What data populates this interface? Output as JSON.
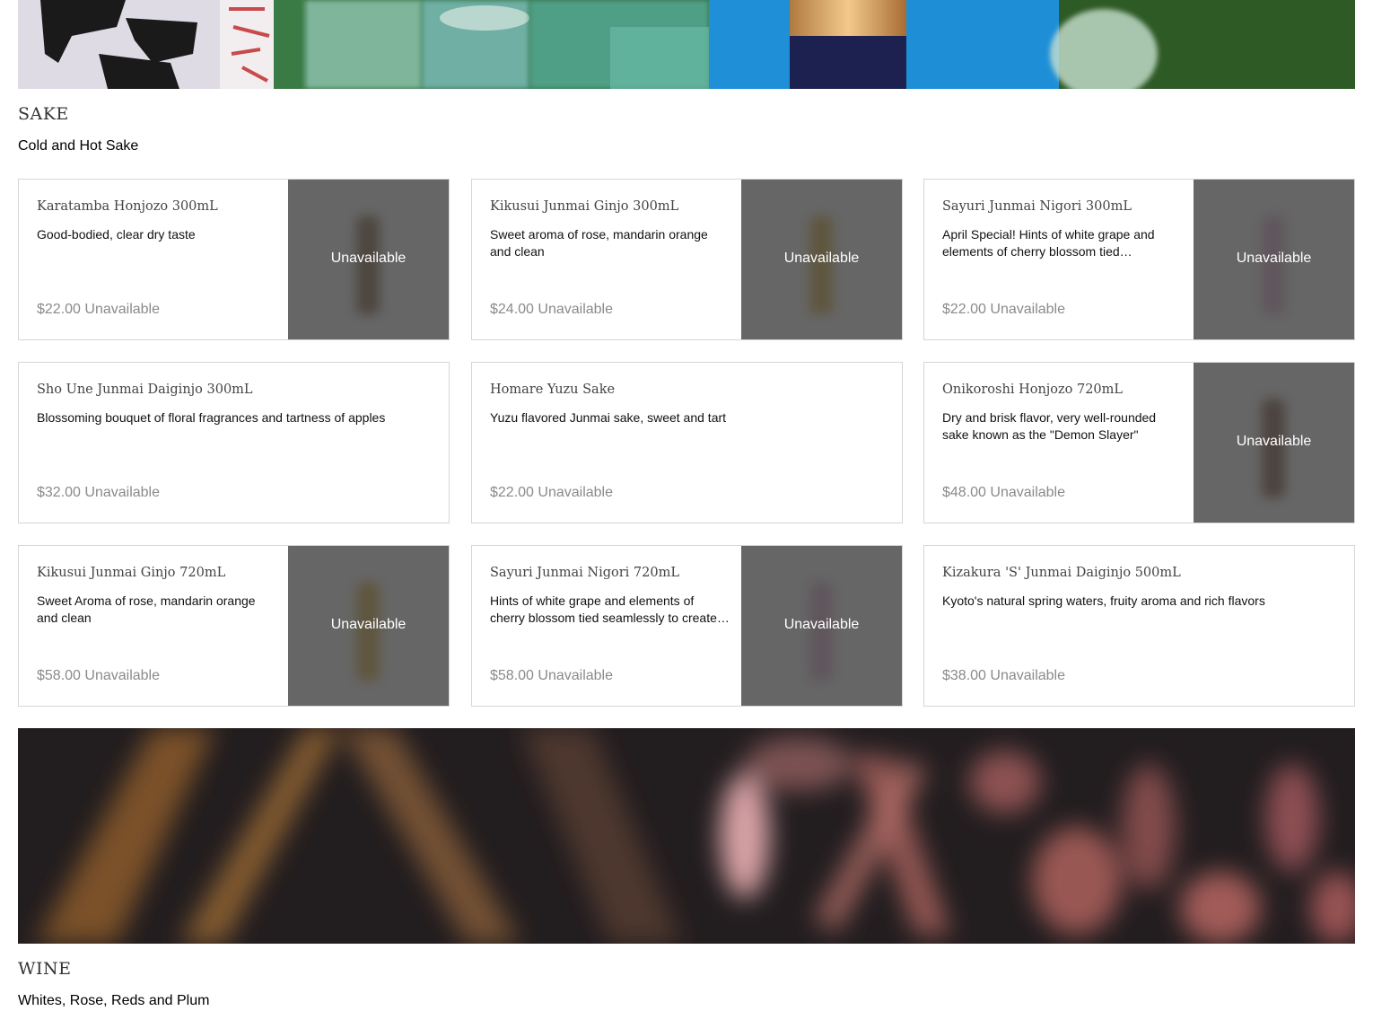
{
  "sections": [
    {
      "title": "SAKE",
      "subtitle": "Cold and Hot Sake"
    },
    {
      "title": "WINE",
      "subtitle": "Whites, Rose, Reds and Plum"
    }
  ],
  "overlay_label": "Unavailable",
  "items": [
    {
      "name": "Karatamba Honjozo 300mL",
      "description": "Good-bodied, clear dry taste",
      "price": "$22.00",
      "status": "Unavailable",
      "bottle_color": "#3a2e22"
    },
    {
      "name": "Kikusui Junmai Ginjo 300mL",
      "description": "Sweet aroma of rose, mandarin orange and clean",
      "price": "$24.00",
      "status": "Unavailable",
      "bottle_color": "#5a4a20"
    },
    {
      "name": "Sayuri Junmai Nigori 300mL",
      "description": "April Special! Hints of white grape and elements of cherry blossom tied seamlessly to create a creamy texture",
      "price": "$22.00",
      "status": "Unavailable",
      "bottle_color": "#5a4a55"
    },
    {
      "name": "Sho Une Junmai Daiginjo 300mL",
      "description": "Blossoming bouquet of floral fragrances and tartness of apples",
      "price": "$32.00",
      "status": "Unavailable"
    },
    {
      "name": "Homare Yuzu Sake",
      "description": "Yuzu flavored Junmai sake, sweet and tart",
      "price": "$22.00",
      "status": "Unavailable"
    },
    {
      "name": "Onikoroshi Honjozo 720mL",
      "description": "Dry and brisk flavor, very well-rounded sake known as the \"Demon Slayer\"",
      "price": "$48.00",
      "status": "Unavailable",
      "bottle_color": "#3a2820"
    },
    {
      "name": "Kikusui Junmai Ginjo 720mL",
      "description": "Sweet Aroma of rose, mandarin orange and clean",
      "price": "$58.00",
      "status": "Unavailable",
      "bottle_color": "#5a4a20"
    },
    {
      "name": "Sayuri Junmai Nigori 720mL",
      "description": "Hints of white grape and elements of cherry blossom tied seamlessly to create a creamy texture",
      "price": "$58.00",
      "status": "Unavailable",
      "bottle_color": "#5a4a55"
    },
    {
      "name": "Kizakura 'S' Junmai Daiginjo 500mL",
      "description": "Kyoto's natural spring waters, fruity aroma and rich flavors",
      "price": "$38.00",
      "status": "Unavailable"
    }
  ]
}
